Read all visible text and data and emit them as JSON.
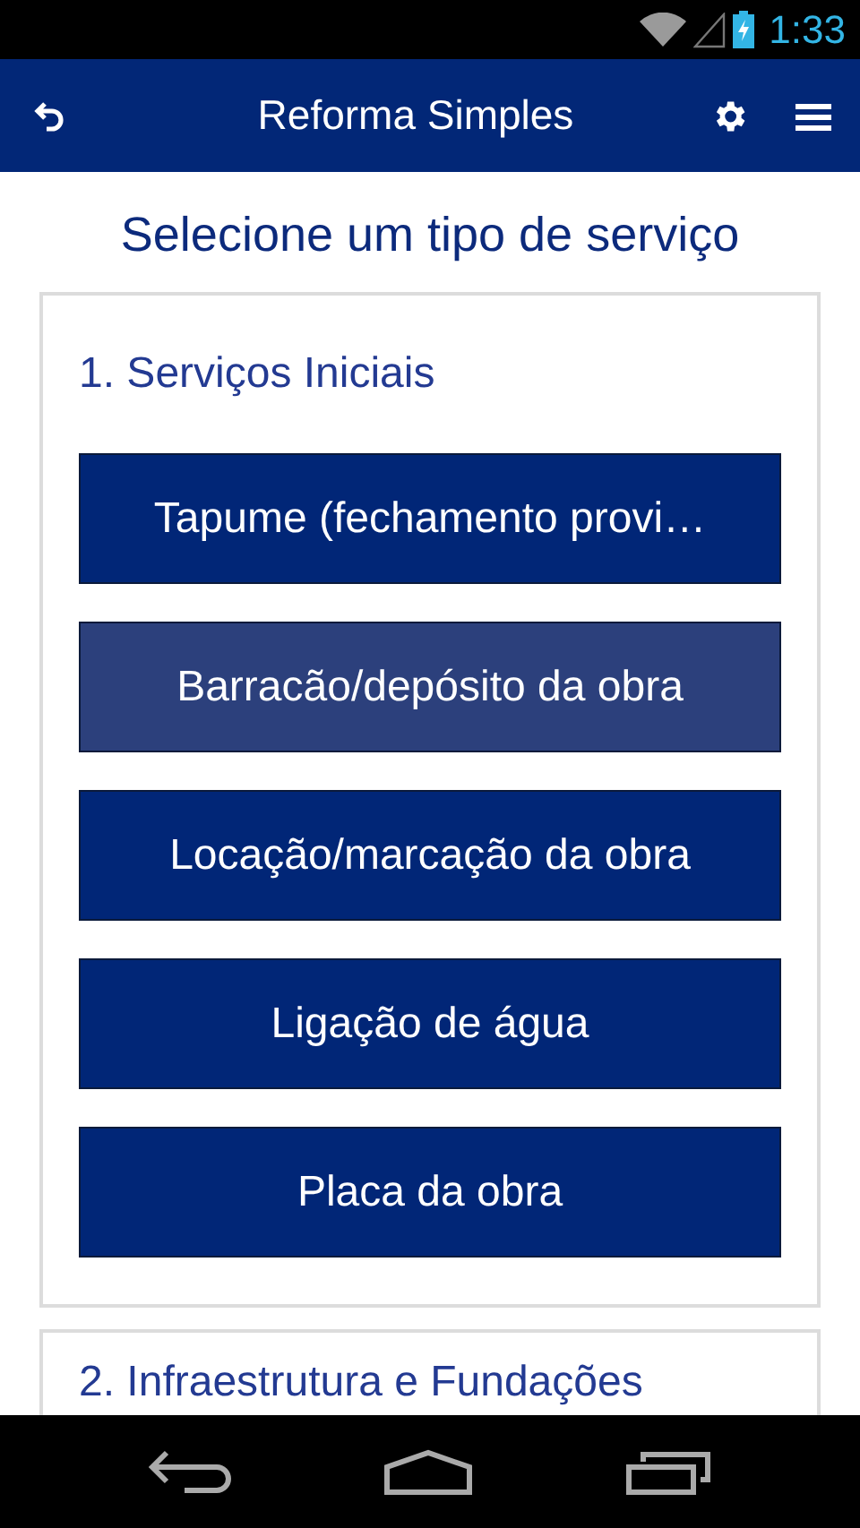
{
  "status_bar": {
    "time": "1:33"
  },
  "app_bar": {
    "title": "Reforma Simples"
  },
  "heading": "Selecione um tipo de serviço",
  "sections": [
    {
      "title": "1. Serviços Iniciais",
      "items": [
        {
          "label": "Tapume (fechamento provi…",
          "pressed": false
        },
        {
          "label": "Barracão/depósito da obra",
          "pressed": true
        },
        {
          "label": "Locação/marcação da obra",
          "pressed": false
        },
        {
          "label": "Ligação de água",
          "pressed": false
        },
        {
          "label": "Placa da obra",
          "pressed": false
        }
      ]
    },
    {
      "title": "2. Infraestrutura e Fundações"
    }
  ]
}
